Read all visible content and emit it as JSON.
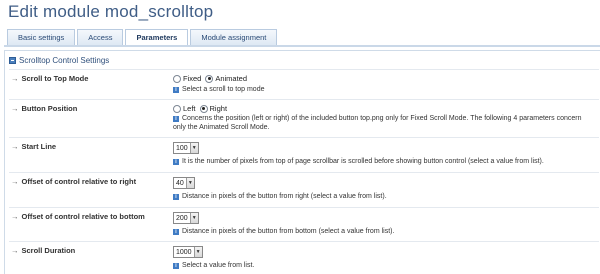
{
  "header": {
    "title": "Edit module mod_scrolltop"
  },
  "tabs": [
    {
      "label": "Basic settings"
    },
    {
      "label": "Access"
    },
    {
      "label": "Parameters"
    },
    {
      "label": "Module assignment"
    }
  ],
  "section": {
    "title": "Scrolltop Control Settings"
  },
  "rows": [
    {
      "label": "Scroll to Top Mode",
      "options": [
        "Fixed",
        "Animated"
      ],
      "selected": "Animated",
      "description": "Select a scroll to top mode"
    },
    {
      "label": "Button Position",
      "options": [
        "Left",
        "Right"
      ],
      "selected": "Right",
      "description": "Concerns the position (left or right) of the included button top.png only for Fixed Scroll Mode. The following 4 parameters concern only the Animated Scroll Mode."
    },
    {
      "label": "Start Line",
      "value": "100",
      "description": "It is the number of pixels from top of page scrollbar is scrolled before showing button control (select a value from list)."
    },
    {
      "label": "Offset of control relative to right",
      "value": "40",
      "description": "Distance in pixels of the button from right (select a value from list)."
    },
    {
      "label": "Offset of control relative to bottom",
      "value": "200",
      "description": "Distance in pixels of the button from bottom (select a value from list)."
    },
    {
      "label": "Scroll Duration",
      "value": "1000",
      "description": "Select a value from list."
    }
  ],
  "icons": {
    "arrow": "→",
    "dropdown": "▼",
    "info": "i"
  },
  "colors": {
    "title": "#3f5d86",
    "tab_border": "#b9cbe0",
    "info": "#3f7bc4"
  }
}
